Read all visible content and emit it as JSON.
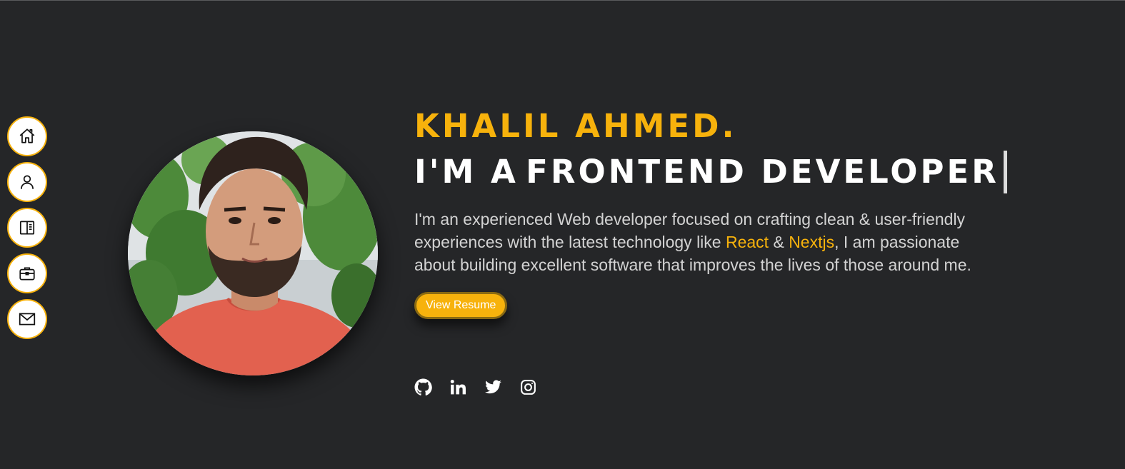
{
  "nav": {
    "items": [
      {
        "icon": "home-icon"
      },
      {
        "icon": "user-icon"
      },
      {
        "icon": "book-icon"
      },
      {
        "icon": "briefcase-icon"
      },
      {
        "icon": "mail-icon"
      }
    ]
  },
  "hero": {
    "name": "KHALIL AHMED.",
    "role_prefix": "I'M A",
    "role_title": "FRONTEND DEVELOPER",
    "bio_part1": "I'm an experienced Web developer focused on crafting clean & user-friendly experiences with the latest technology like ",
    "bio_highlight1": "React",
    "bio_part2": " & ",
    "bio_highlight2": "Nextjs",
    "bio_part3": ", I am passionate about building excellent software that improves the lives of those around me.",
    "resume_label": "View Resume"
  },
  "socials": [
    {
      "icon": "github-icon"
    },
    {
      "icon": "linkedin-icon"
    },
    {
      "icon": "twitter-icon"
    },
    {
      "icon": "instagram-icon"
    }
  ],
  "colors": {
    "background": "#252628",
    "accent": "#f7b20c",
    "text": "#d3d3d3"
  }
}
